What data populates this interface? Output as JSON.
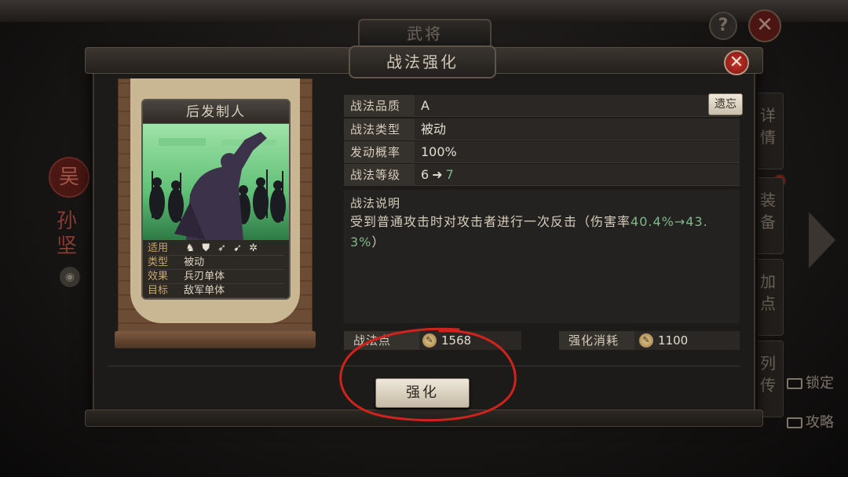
{
  "background": {
    "title": "武将",
    "help": "?",
    "close": "✕",
    "hero": {
      "seal": "吴",
      "name": "孙坚",
      "voice": "◉"
    },
    "side_tabs": [
      "详情",
      "装备",
      "加点",
      "列传"
    ],
    "right_buttons": [
      {
        "label": "锁定"
      },
      {
        "label": "攻略"
      }
    ]
  },
  "modal": {
    "title": "战法强化",
    "close": "✕",
    "card": {
      "name": "后发制人",
      "rows": [
        {
          "key": "适用",
          "value": ""
        },
        {
          "key": "类型",
          "value": "被动"
        },
        {
          "key": "效果",
          "value": "兵刃单体"
        },
        {
          "key": "目标",
          "value": "敌军单体"
        }
      ],
      "troop_icons": [
        "cavalry-icon",
        "shield-icon",
        "archer-icon",
        "spear-icon",
        "chariot-icon"
      ]
    },
    "info": {
      "quality": {
        "label": "战法品质",
        "value": "A"
      },
      "type": {
        "label": "战法类型",
        "value": "被动"
      },
      "rate": {
        "label": "发动概率",
        "value": "100%"
      },
      "level": {
        "label": "战法等级",
        "from": "6",
        "arrow": "➜",
        "to": "7"
      }
    },
    "inherit_button": "遗忘",
    "description": {
      "title": "战法说明",
      "text_prefix": "受到普通攻击时对攻击者进行一次反击（伤害率",
      "text_highlight": "40.4%→43.3%",
      "text_suffix": "）"
    },
    "points": {
      "label": "战法点",
      "value": "1568"
    },
    "cost": {
      "label": "强化消耗",
      "value": "1100"
    },
    "enhance_button": "强化"
  },
  "colors": {
    "accent_green": "#7fb98a",
    "close_red": "#c9362c",
    "annotation": "#d0231c"
  }
}
